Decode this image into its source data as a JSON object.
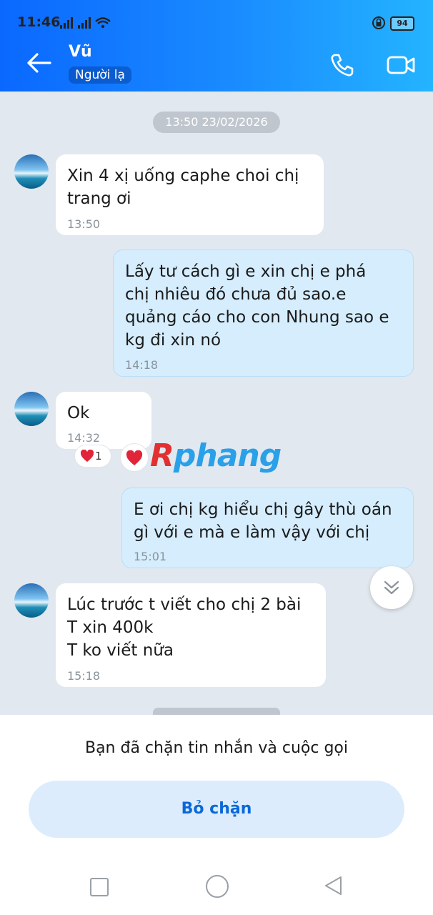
{
  "status_bar": {
    "time": "11:46",
    "battery": "94"
  },
  "header": {
    "contact_name": "Vũ",
    "badge": "Người lạ"
  },
  "icons": [
    "back-arrow-icon",
    "phone-icon",
    "video-call-icon",
    "heart-icon",
    "chevron-double-down-icon"
  ],
  "date_separator": "13:50 23/02/2026",
  "messages": [
    {
      "direction": "in",
      "text": "Xin 4 xị uống caphe choi chị\ntrang ơi",
      "time": "13:50"
    },
    {
      "direction": "out",
      "text": "Lấy tư cách gì e xin chị e phá\nchị nhiêu đó chưa đủ sao.e\nquảng cáo cho con Nhung sao e\nkg đi xin nó",
      "time": "14:18"
    },
    {
      "direction": "in",
      "text": "Ok",
      "time": "14:32",
      "reaction_count": "1"
    },
    {
      "direction": "out",
      "text": "E ơi chị kg hiểu chị gây thù oán\ngì với e mà e làm vậy với chị",
      "time": "15:01"
    },
    {
      "direction": "in",
      "text": "Lúc trước t viết cho chị 2 bài\nT xin 400k\nT ko viết nữa",
      "time": "15:18"
    }
  ],
  "watermark": {
    "first": "R",
    "rest": "phang"
  },
  "blocked_panel": {
    "message": "Bạn đã chặn tin nhắn và cuộc gọi",
    "unblock_label": "Bỏ chặn"
  },
  "colors": {
    "header_start": "#0a68ff",
    "header_end": "#24b4ff",
    "outgoing_bubble": "#d5edfd",
    "unblock_bg": "#dcecfc",
    "unblock_text": "#0a68d8"
  }
}
